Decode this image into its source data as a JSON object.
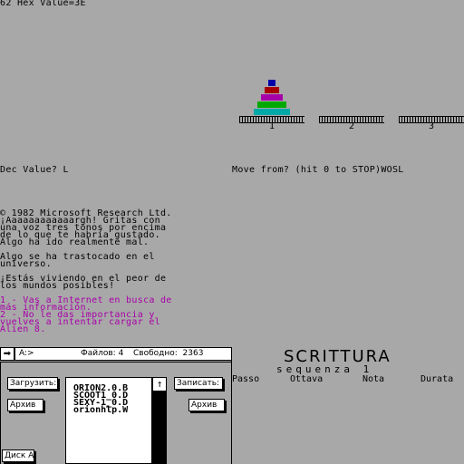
{
  "top_text": "62 Hex Value=3E",
  "hanoi": {
    "peg_labels": [
      "1",
      "2",
      "3"
    ],
    "disk_colors": [
      "#0000a8",
      "#a80000",
      "#a800a8",
      "#00a800",
      "#00a8a8"
    ]
  },
  "prompts": {
    "dec_value": "Dec Value? L",
    "move_from": "Move from? (hit 0 to STOP)WOSL"
  },
  "message": {
    "lines_black": [
      "© 1982 Microsoft Research Ltd.",
      "¡Aaaaaaaaaaaargh! Gritas con",
      "una voz tres tonos por encima",
      "de lo que te habría gustado.",
      "Algo ha ido realmente mal.",
      "",
      "Algo se ha trastocado en el",
      "universo.",
      "",
      "¡Estás viviendo en el peor de",
      "los mundos posibles!",
      ""
    ],
    "lines_magenta": [
      "1 - Vas a Internet en busca de",
      "más información.",
      "2 - No le das importancia y",
      "vuelves a intentar cargar el",
      "Alien 8."
    ]
  },
  "scrittura": {
    "title": "SCRITTURA",
    "subtitle": "sequenza 1",
    "columns": [
      "Passo",
      "Ottava",
      "Nota",
      "Durata"
    ]
  },
  "file_manager": {
    "arrow": "➡",
    "drive": "A:>",
    "files_label": "Файлов: 4",
    "free_label": "Свободно:  2363",
    "load_button": "Загрузить:",
    "save_button": "Записать:",
    "archive_left": "Архив",
    "archive_right": "Архив",
    "disk_button": "Диск А",
    "files": [
      "ORION2.0.B",
      "SCOOT1_0.D",
      "SEXY-1_0.D",
      "orionhlp.W"
    ],
    "scroll_up": "↑"
  }
}
